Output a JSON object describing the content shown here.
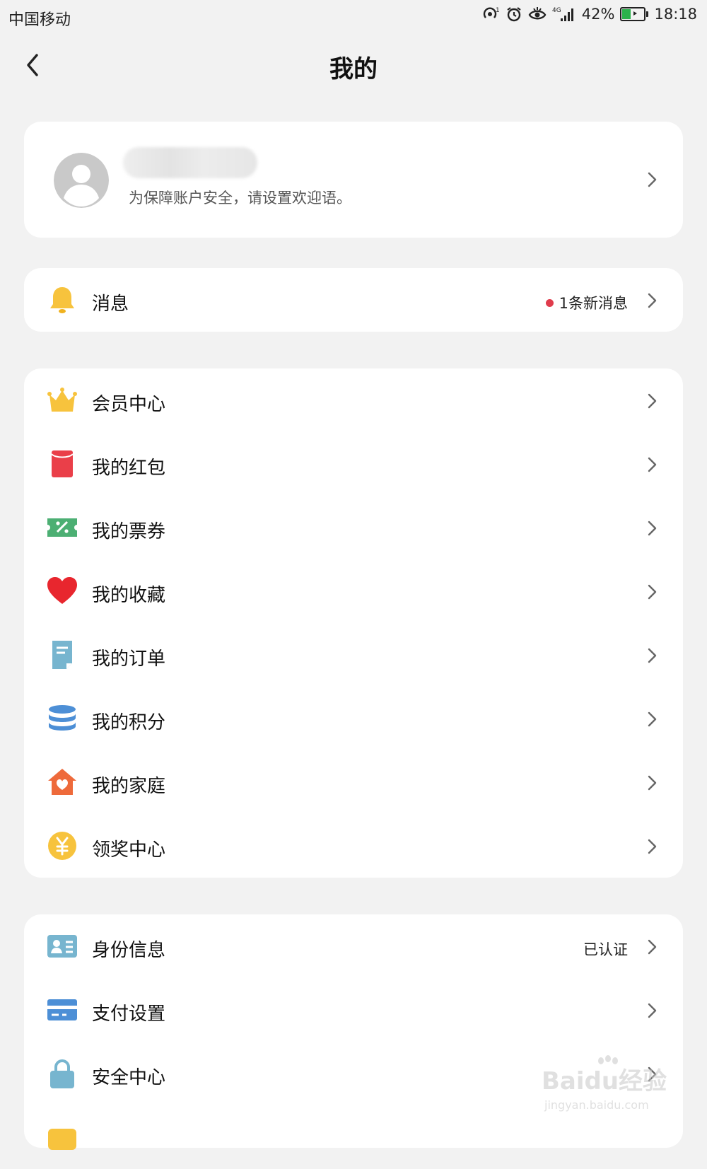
{
  "status": {
    "carrier": "中国移动",
    "battery": "42%",
    "time": "18:18",
    "network": "4G"
  },
  "nav": {
    "title": "我的"
  },
  "profile": {
    "hint": "为保障账户安全，请设置欢迎语。"
  },
  "message": {
    "label": "消息",
    "badge": "1条新消息",
    "badge_color": "#e03c4c"
  },
  "menu": {
    "items": [
      {
        "label": "会员中心",
        "icon": "crown-icon"
      },
      {
        "label": "我的红包",
        "icon": "red-envelope-icon"
      },
      {
        "label": "我的票券",
        "icon": "coupon-icon"
      },
      {
        "label": "我的收藏",
        "icon": "heart-icon"
      },
      {
        "label": "我的订单",
        "icon": "order-document-icon"
      },
      {
        "label": "我的积分",
        "icon": "points-stack-icon"
      },
      {
        "label": "我的家庭",
        "icon": "home-heart-icon"
      },
      {
        "label": "领奖中心",
        "icon": "yuan-coin-icon"
      }
    ]
  },
  "settings": {
    "items": [
      {
        "label": "身份信息",
        "icon": "id-card-icon",
        "status": "已认证"
      },
      {
        "label": "支付设置",
        "icon": "bank-card-icon"
      },
      {
        "label": "安全中心",
        "icon": "lock-icon"
      }
    ]
  },
  "watermark": {
    "text1": "Baidu经验",
    "text2": "jingyan.baidu.com"
  }
}
